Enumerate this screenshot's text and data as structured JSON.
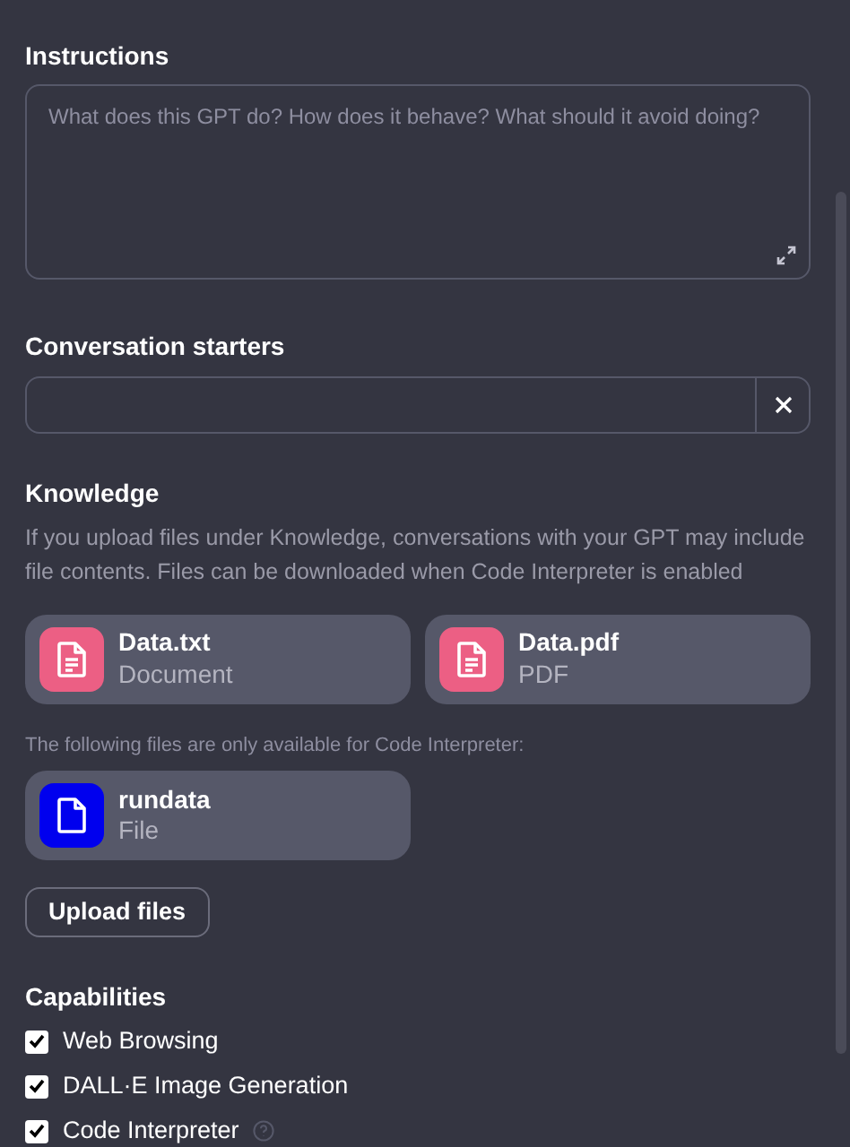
{
  "instructions": {
    "label": "Instructions",
    "placeholder": "What does this GPT do? How does it behave? What should it avoid doing?"
  },
  "conversation_starters": {
    "label": "Conversation starters"
  },
  "knowledge": {
    "label": "Knowledge",
    "description": "If you upload files under Knowledge, conversations with your GPT may include file contents. Files can be downloaded when Code Interpreter is enabled",
    "files": [
      {
        "name": "Data.txt",
        "type": "Document",
        "color": "#ec5f84",
        "kind": "doc"
      },
      {
        "name": "Data.pdf",
        "type": "PDF",
        "color": "#ec5f84",
        "kind": "doc"
      }
    ],
    "interpreter_note": "The following files are only available for Code Interpreter:",
    "interpreter_files": [
      {
        "name": "rundata",
        "type": "File",
        "color": "#0000ee",
        "kind": "file"
      }
    ],
    "upload_button": "Upload files"
  },
  "capabilities": {
    "label": "Capabilities",
    "items": [
      {
        "label": "Web Browsing",
        "checked": true,
        "help": false
      },
      {
        "label": "DALL·E Image Generation",
        "checked": true,
        "help": false
      },
      {
        "label": "Code Interpreter",
        "checked": true,
        "help": true
      }
    ]
  }
}
